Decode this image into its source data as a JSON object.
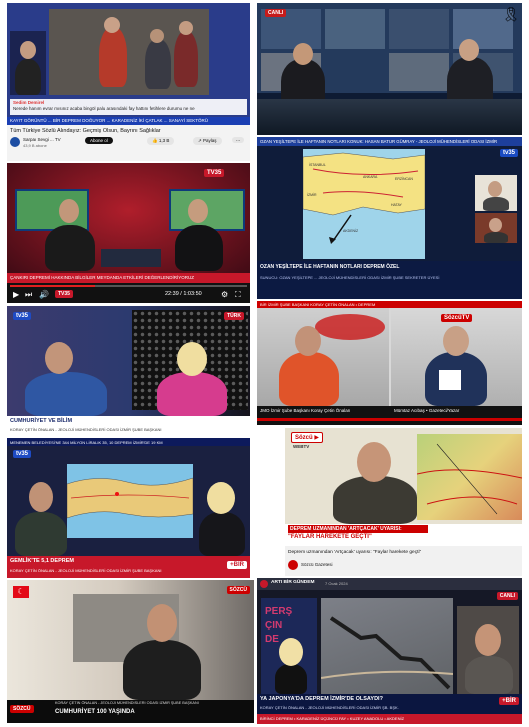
{
  "tiles": {
    "t1": {
      "comment_user": "Sedim Demirel",
      "comment_text": "Nerede hanım evrar mısınız acaba bingöl palu arasındaki fay hattını fetihlere durumu ne ne",
      "ticker": "KAYIT GÖRÜNTÜ ... BİR DEPREM DOĞUYOR ... KARADENİZ İKİ ÇATLAK ... SANAYİ SEKTÖRÜ",
      "ticker_right": "ERKAN BELEDİYESİ VE İL İKİ YATLAR",
      "video_title": "Tüm Türkiye Sözlü Alındayız: Geçmiş Olsun, Bayrını Sağlıklar",
      "channel_name": "Sarpaı Sevgi ... TV",
      "channel_subs": "43,9 B abone",
      "subscribe_label": "Abone ol",
      "likes": "1,3 B",
      "share_label": "Paylaş",
      "more_label": "..."
    },
    "t2": {
      "overlay_text": "CANLI"
    },
    "t3": {
      "logo": "TV35",
      "ticker": "ÇANKIRI DEPREMİ HAKKINDA BİLGİLER MEYDANDA ETKİLERİ DEĞERLENDİRİYORUZ",
      "time": "22:39 / 1:03:50",
      "bar_logo": "TV35"
    },
    "t4": {
      "header_bar": "OZAN YEŞİLTEPE İLE HAFTANIN NOTLARI  KONUK: HASAN BATUR GÜMRAY - JEOLOJİ MÜHENDİSLERİ ODASI İZMİR",
      "logo": "tv35",
      "map_labels": [
        "ANKARA",
        "İSTANBUL",
        "İZMİR",
        "ERZİNCAN",
        "HATAY",
        "AKDENİZ"
      ],
      "lower_title": "OZAN YEŞİLTEPE İLE HAFTANIN NOTLARI DEPREM ÖZEL",
      "lower_ticker": "SUNUCU: OZAN YEŞİLTEPE ... JEOLOJİ MÜHENDİSLERİ ODASI İZMİR ŞUBE SEKRETER ÜYESİ"
    },
    "t5": {
      "logo": "tv35",
      "corner_badge": "TÜRK",
      "ticker": "CUMHURİYET VE BİLİM",
      "sub_ticker": "KORAY ÇETİN ÖNALAN - JEOLOJİ MÜHENDİSLERİ ODASI İZMİR ŞUBE BAŞKANI"
    },
    "t6": {
      "banner_text": "SözcüTV",
      "top_ticker": "BİR İZMİR ŞUBE BAŞKANI KORAY ÇETİN ÖNALAN • DEPREM",
      "name_left": "JMO İzmir Şube Başkanı Koray Çetin Önalan",
      "name_right": "Mümtaz Acıbaş • Gazeteci/Yazar",
      "live": "CANLI"
    },
    "t7": {
      "logo": "tv35",
      "top_ticker": "MENEMEN BELEDİYESİ'NE 344 MİLYON LİRALIK 35, 10 DEPREM İZMİR'DE 19 KM",
      "caption": "GEMLİK'TE 5,1 DEPREM",
      "sub_caption": "KORAY ÇETİN ÖNALAN - JEOLOJİ MÜHENDİSLERİ ODASI İZMİR ŞUBE BAŞKANI",
      "corner": "+BİR"
    },
    "t8": {
      "logo": "Sözcü",
      "logo_sub": "WEBTV",
      "caption_red": "DEPREM UZMANINDAN 'ARTÇACAK' UYARISI:",
      "caption_white": "\"FAYLAR HAREKETE GEÇTİ\"",
      "video_title": "Deprem uzmanından 'Artçacak' uyarısı: \"Faylar harekete geçti\"",
      "channel_name": "Sözcü Gazetesi"
    },
    "t9": {
      "badge": "SÖZCÜ",
      "caption_top": "KORAY ÇETİN ÖNALAN - JEOLOJİ MÜHENDİSLERİ ODASI İZMİR ŞUBE BAŞKANI",
      "caption": "CUMHURİYET 100 YAŞINDA",
      "corner": "SÖZCÜ"
    },
    "t10": {
      "channel": "ARTI BİR GÜNDEM",
      "channel_date": "7 Ocak 2024",
      "live": "CANLI",
      "side_text": [
        "PERŞ",
        "ÇIN",
        "DE"
      ],
      "caption": "YA JAPONYA'DA DEPREM İZMİR'DE OLSAYDI?",
      "sub_caption": "KORAY ÇETİN ÖNALAN - JEOLOJİ MÜHENDİSLERİ ODASI İZMİR ŞB. BŞK.",
      "corner": "+BİR",
      "ticker": "BİRİNCİ DEPREM • KARADENİZ ÜÇÜNCÜ FAY • KUZEY ANADOLU • AKDENİZ"
    }
  }
}
